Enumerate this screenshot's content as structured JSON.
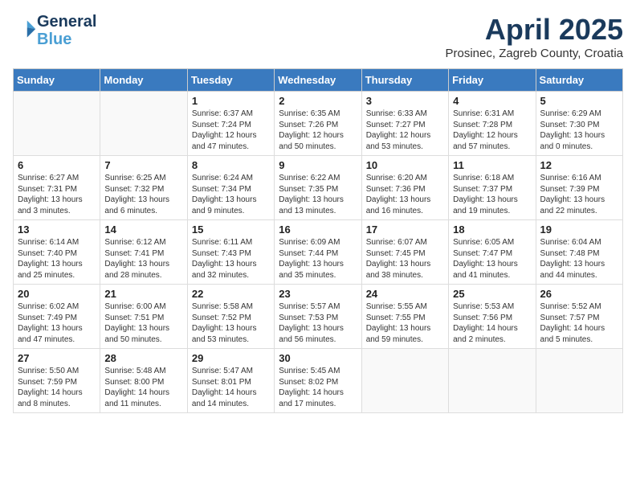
{
  "logo": {
    "line1": "General",
    "line2": "Blue"
  },
  "title": "April 2025",
  "subtitle": "Prosinec, Zagreb County, Croatia",
  "days_of_week": [
    "Sunday",
    "Monday",
    "Tuesday",
    "Wednesday",
    "Thursday",
    "Friday",
    "Saturday"
  ],
  "weeks": [
    [
      {
        "day": "",
        "info": ""
      },
      {
        "day": "",
        "info": ""
      },
      {
        "day": "1",
        "info": "Sunrise: 6:37 AM\nSunset: 7:24 PM\nDaylight: 12 hours and 47 minutes."
      },
      {
        "day": "2",
        "info": "Sunrise: 6:35 AM\nSunset: 7:26 PM\nDaylight: 12 hours and 50 minutes."
      },
      {
        "day": "3",
        "info": "Sunrise: 6:33 AM\nSunset: 7:27 PM\nDaylight: 12 hours and 53 minutes."
      },
      {
        "day": "4",
        "info": "Sunrise: 6:31 AM\nSunset: 7:28 PM\nDaylight: 12 hours and 57 minutes."
      },
      {
        "day": "5",
        "info": "Sunrise: 6:29 AM\nSunset: 7:30 PM\nDaylight: 13 hours and 0 minutes."
      }
    ],
    [
      {
        "day": "6",
        "info": "Sunrise: 6:27 AM\nSunset: 7:31 PM\nDaylight: 13 hours and 3 minutes."
      },
      {
        "day": "7",
        "info": "Sunrise: 6:25 AM\nSunset: 7:32 PM\nDaylight: 13 hours and 6 minutes."
      },
      {
        "day": "8",
        "info": "Sunrise: 6:24 AM\nSunset: 7:34 PM\nDaylight: 13 hours and 9 minutes."
      },
      {
        "day": "9",
        "info": "Sunrise: 6:22 AM\nSunset: 7:35 PM\nDaylight: 13 hours and 13 minutes."
      },
      {
        "day": "10",
        "info": "Sunrise: 6:20 AM\nSunset: 7:36 PM\nDaylight: 13 hours and 16 minutes."
      },
      {
        "day": "11",
        "info": "Sunrise: 6:18 AM\nSunset: 7:37 PM\nDaylight: 13 hours and 19 minutes."
      },
      {
        "day": "12",
        "info": "Sunrise: 6:16 AM\nSunset: 7:39 PM\nDaylight: 13 hours and 22 minutes."
      }
    ],
    [
      {
        "day": "13",
        "info": "Sunrise: 6:14 AM\nSunset: 7:40 PM\nDaylight: 13 hours and 25 minutes."
      },
      {
        "day": "14",
        "info": "Sunrise: 6:12 AM\nSunset: 7:41 PM\nDaylight: 13 hours and 28 minutes."
      },
      {
        "day": "15",
        "info": "Sunrise: 6:11 AM\nSunset: 7:43 PM\nDaylight: 13 hours and 32 minutes."
      },
      {
        "day": "16",
        "info": "Sunrise: 6:09 AM\nSunset: 7:44 PM\nDaylight: 13 hours and 35 minutes."
      },
      {
        "day": "17",
        "info": "Sunrise: 6:07 AM\nSunset: 7:45 PM\nDaylight: 13 hours and 38 minutes."
      },
      {
        "day": "18",
        "info": "Sunrise: 6:05 AM\nSunset: 7:47 PM\nDaylight: 13 hours and 41 minutes."
      },
      {
        "day": "19",
        "info": "Sunrise: 6:04 AM\nSunset: 7:48 PM\nDaylight: 13 hours and 44 minutes."
      }
    ],
    [
      {
        "day": "20",
        "info": "Sunrise: 6:02 AM\nSunset: 7:49 PM\nDaylight: 13 hours and 47 minutes."
      },
      {
        "day": "21",
        "info": "Sunrise: 6:00 AM\nSunset: 7:51 PM\nDaylight: 13 hours and 50 minutes."
      },
      {
        "day": "22",
        "info": "Sunrise: 5:58 AM\nSunset: 7:52 PM\nDaylight: 13 hours and 53 minutes."
      },
      {
        "day": "23",
        "info": "Sunrise: 5:57 AM\nSunset: 7:53 PM\nDaylight: 13 hours and 56 minutes."
      },
      {
        "day": "24",
        "info": "Sunrise: 5:55 AM\nSunset: 7:55 PM\nDaylight: 13 hours and 59 minutes."
      },
      {
        "day": "25",
        "info": "Sunrise: 5:53 AM\nSunset: 7:56 PM\nDaylight: 14 hours and 2 minutes."
      },
      {
        "day": "26",
        "info": "Sunrise: 5:52 AM\nSunset: 7:57 PM\nDaylight: 14 hours and 5 minutes."
      }
    ],
    [
      {
        "day": "27",
        "info": "Sunrise: 5:50 AM\nSunset: 7:59 PM\nDaylight: 14 hours and 8 minutes."
      },
      {
        "day": "28",
        "info": "Sunrise: 5:48 AM\nSunset: 8:00 PM\nDaylight: 14 hours and 11 minutes."
      },
      {
        "day": "29",
        "info": "Sunrise: 5:47 AM\nSunset: 8:01 PM\nDaylight: 14 hours and 14 minutes."
      },
      {
        "day": "30",
        "info": "Sunrise: 5:45 AM\nSunset: 8:02 PM\nDaylight: 14 hours and 17 minutes."
      },
      {
        "day": "",
        "info": ""
      },
      {
        "day": "",
        "info": ""
      },
      {
        "day": "",
        "info": ""
      }
    ]
  ]
}
